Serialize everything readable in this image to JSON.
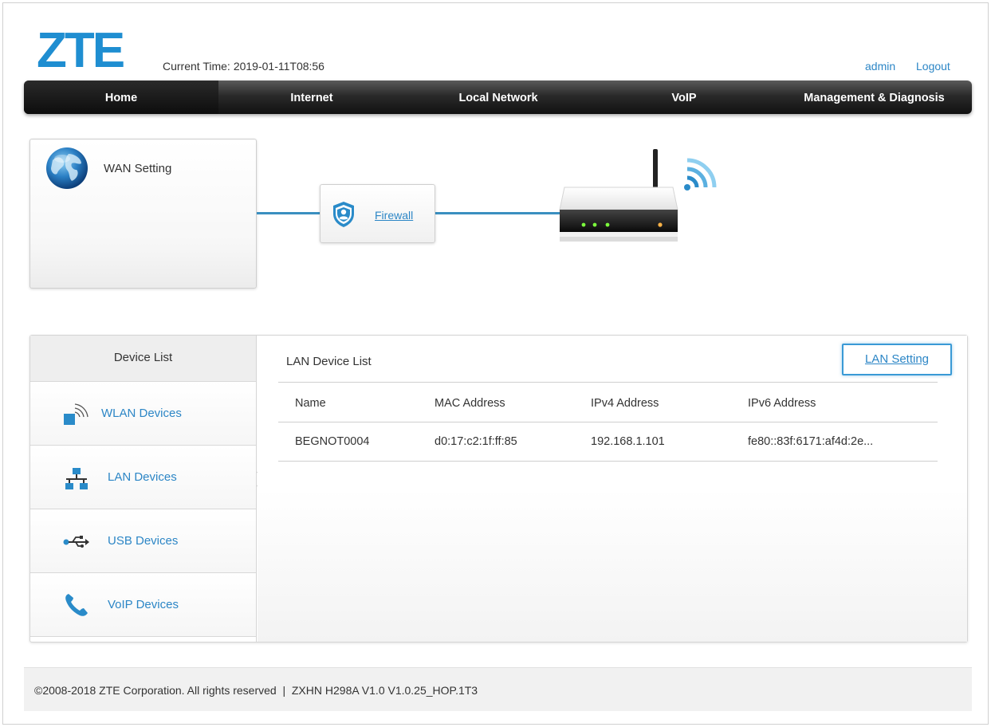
{
  "header": {
    "brand": "ZTE",
    "current_time_label": "Current Time:",
    "current_time_value": "2019-01-11T08:56",
    "user": "admin",
    "logout": "Logout"
  },
  "nav": {
    "items": [
      {
        "label": "Home",
        "active": true
      },
      {
        "label": "Internet"
      },
      {
        "label": "Local Network"
      },
      {
        "label": "VoIP"
      },
      {
        "label": "Management & Diagnosis"
      }
    ]
  },
  "topology": {
    "wan_label": "WAN Setting",
    "firewall_label": "Firewall",
    "icons": [
      "globe-icon",
      "shield-icon",
      "router-icon",
      "wifi-signal-icon"
    ],
    "accent_color": "#3a8fc0"
  },
  "device_list": {
    "title": "Device List",
    "items": [
      {
        "label": "WLAN Devices",
        "icon": "wlan-icon"
      },
      {
        "label": "LAN Devices",
        "icon": "network-icon",
        "selected": true
      },
      {
        "label": "USB Devices",
        "icon": "usb-icon"
      },
      {
        "label": "VoIP Devices",
        "icon": "phone-icon"
      }
    ]
  },
  "lan_list": {
    "title": "LAN Device List",
    "setting_button": "LAN Setting",
    "columns": [
      "Name",
      "MAC Address",
      "IPv4 Address",
      "IPv6 Address"
    ],
    "rows": [
      [
        "BEGNOT0004",
        "d0:17:c2:1f:ff:85",
        "192.168.1.101",
        "fe80::83f:6171:af4d:2e..."
      ]
    ]
  },
  "footer": {
    "text": "©2008-2018 ZTE Corporation. All rights reserved  |  ZXHN H298A V1.0 V1.0.25_HOP.1T3"
  },
  "colors": {
    "link": "#2c86c6",
    "brand_blue": "#1f8ed1",
    "nav_dark": "#1a1a1a"
  }
}
